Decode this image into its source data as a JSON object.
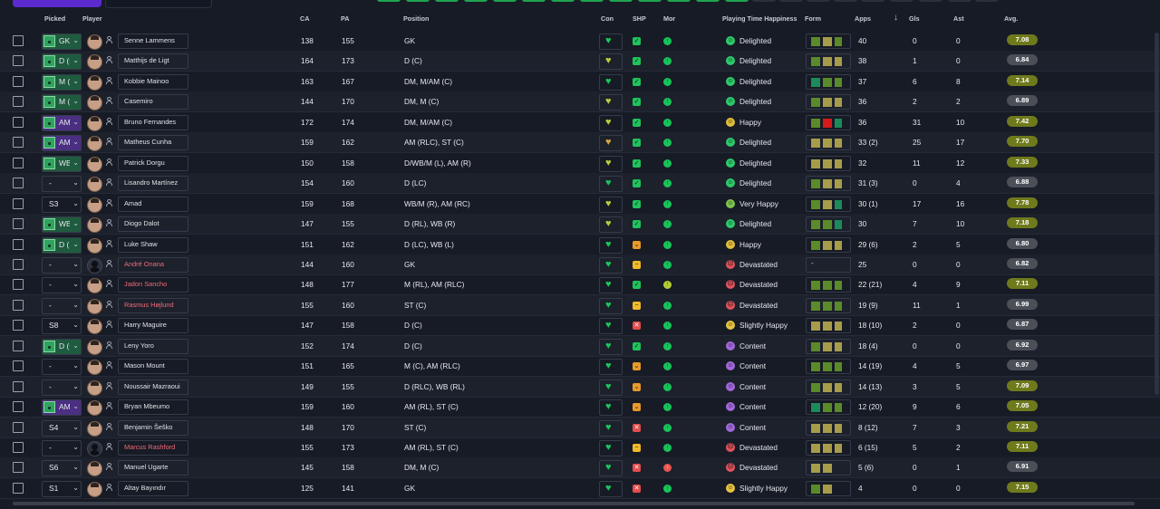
{
  "columns": {
    "picked": "Picked",
    "player": "Player",
    "ca": "CA",
    "pa": "PA",
    "position": "Position",
    "con": "Con",
    "shp": "SHP",
    "mor": "Mor",
    "happiness": "Playing Time Happiness",
    "form": "Form",
    "apps": "Apps",
    "sort_indicator": "↓",
    "gls": "Gls",
    "ast": "Ast",
    "avg": "Avg."
  },
  "colors": {
    "accent": "#5b2bd0",
    "toolbar_green": "#1ea34f",
    "form_green": "#5b8a2a",
    "form_olive": "#a79c4a",
    "form_teal": "#1c8a5b",
    "form_red": "#d41a1a"
  },
  "players": [
    {
      "picked": "GK",
      "pick_style": "g",
      "name": "Senne Lammens",
      "name_color": "white",
      "avatar": "photo",
      "ca": "138",
      "pa": "155",
      "position": "GK",
      "con": "g",
      "shp": "ok",
      "mor": "g",
      "happiness": "Delighted",
      "hap_icon": "dl",
      "form": [
        "#5b8a2a",
        "#a79c4a",
        "#5b8a2a"
      ],
      "apps": "40",
      "gls": "0",
      "ast": "0",
      "avg": "7.08",
      "avg_style": "ol"
    },
    {
      "picked": "D (C)",
      "pick_style": "g",
      "name": "Matthijs de Ligt",
      "name_color": "white",
      "avatar": "photo",
      "ca": "164",
      "pa": "173",
      "position": "D (C)",
      "con": "y",
      "shp": "ok",
      "mor": "g",
      "happiness": "Delighted",
      "hap_icon": "dl",
      "form": [
        "#5b8a2a",
        "#a79c4a",
        "#a79c4a"
      ],
      "apps": "38",
      "gls": "1",
      "ast": "0",
      "avg": "6.84",
      "avg_style": "gr"
    },
    {
      "picked": "M (C)",
      "pick_style": "g",
      "name": "Kobbie Mainoo",
      "name_color": "white",
      "avatar": "photo",
      "ca": "163",
      "pa": "167",
      "position": "DM, M/AM (C)",
      "con": "g",
      "shp": "ok",
      "mor": "g",
      "happiness": "Delighted",
      "hap_icon": "dl",
      "form": [
        "#1c8a5b",
        "#5b8a2a",
        "#5b8a2a"
      ],
      "apps": "37",
      "gls": "6",
      "ast": "8",
      "avg": "7.14",
      "avg_style": "ol"
    },
    {
      "picked": "M (C)",
      "pick_style": "g",
      "name": "Casemiro",
      "name_color": "white",
      "avatar": "photo",
      "ca": "144",
      "pa": "170",
      "position": "DM, M (C)",
      "con": "y",
      "shp": "ok",
      "mor": "g",
      "happiness": "Delighted",
      "hap_icon": "dl",
      "form": [
        "#5b8a2a",
        "#a79c4a",
        "#a79c4a"
      ],
      "apps": "36",
      "gls": "2",
      "ast": "2",
      "avg": "6.89",
      "avg_style": "gr"
    },
    {
      "picked": "AM (C)",
      "pick_style": "p",
      "name": "Bruno Fernandes",
      "name_color": "white",
      "avatar": "photo",
      "ca": "172",
      "pa": "174",
      "position": "DM, M/AM (C)",
      "con": "y",
      "shp": "ok",
      "mor": "g",
      "happiness": "Happy",
      "hap_icon": "hp",
      "form": [
        "#5b8a2a",
        "#d41a1a",
        "#1c8a5b"
      ],
      "apps": "36",
      "gls": "31",
      "ast": "10",
      "avg": "7.42",
      "avg_style": "ol"
    },
    {
      "picked": "AM (C)",
      "pick_style": "p",
      "name": "Matheus Cunha",
      "name_color": "white",
      "avatar": "photo",
      "ca": "159",
      "pa": "162",
      "position": "AM (RLC), ST (C)",
      "con": "o",
      "shp": "ok",
      "mor": "g",
      "happiness": "Delighted",
      "hap_icon": "dl",
      "form": [
        "#a79c4a",
        "#a79c4a",
        "#a79c4a"
      ],
      "apps": "33 (2)",
      "gls": "25",
      "ast": "17",
      "avg": "7.70",
      "avg_style": "ol"
    },
    {
      "picked": "WB (R)",
      "pick_style": "g",
      "name": "Patrick Dorgu",
      "name_color": "white",
      "avatar": "photo",
      "ca": "150",
      "pa": "158",
      "position": "D/WB/M (L), AM (R)",
      "con": "y",
      "shp": "ok",
      "mor": "g",
      "happiness": "Delighted",
      "hap_icon": "dl",
      "form": [
        "#a79c4a",
        "#a79c4a",
        "#a79c4a"
      ],
      "apps": "32",
      "gls": "11",
      "ast": "12",
      "avg": "7.33",
      "avg_style": "ol"
    },
    {
      "picked": "-",
      "pick_style": "ng",
      "name": "Lisandro Martínez",
      "name_color": "white",
      "avatar": "photo",
      "ca": "154",
      "pa": "160",
      "position": "D (LC)",
      "con": "g",
      "shp": "ok",
      "mor": "g",
      "happiness": "Delighted",
      "hap_icon": "dl",
      "form": [
        "#5b8a2a",
        "#a79c4a",
        "#a79c4a"
      ],
      "apps": "31 (3)",
      "gls": "0",
      "ast": "4",
      "avg": "6.88",
      "avg_style": "gr"
    },
    {
      "picked": "S3",
      "pick_style": "ng",
      "name": "Amad",
      "name_color": "white",
      "avatar": "photo",
      "ca": "159",
      "pa": "168",
      "position": "WB/M (R), AM (RC)",
      "con": "y",
      "shp": "ok",
      "mor": "g",
      "happiness": "Very Happy",
      "hap_icon": "vh",
      "form": [
        "#5b8a2a",
        "#a79c4a",
        "#1c8a5b"
      ],
      "apps": "30 (1)",
      "gls": "17",
      "ast": "16",
      "avg": "7.78",
      "avg_style": "ol"
    },
    {
      "picked": "WB (R)",
      "pick_style": "g",
      "name": "Diogo Dalot",
      "name_color": "white",
      "avatar": "photo",
      "ca": "147",
      "pa": "155",
      "position": "D (RL), WB (R)",
      "con": "y",
      "shp": "ok",
      "mor": "g",
      "happiness": "Delighted",
      "hap_icon": "dl",
      "form": [
        "#5b8a2a",
        "#5b8a2a",
        "#1c8a5b"
      ],
      "apps": "30",
      "gls": "7",
      "ast": "10",
      "avg": "7.18",
      "avg_style": "ol"
    },
    {
      "picked": "D (L)",
      "pick_style": "g",
      "name": "Luke Shaw",
      "name_color": "white",
      "avatar": "photo",
      "ca": "151",
      "pa": "162",
      "position": "D (LC), WB (L)",
      "con": "g",
      "shp": "warn",
      "mor": "g",
      "happiness": "Happy",
      "hap_icon": "hp",
      "form": [
        "#5b8a2a",
        "#a79c4a",
        "#a79c4a"
      ],
      "apps": "29 (6)",
      "gls": "2",
      "ast": "5",
      "avg": "6.80",
      "avg_style": "gr"
    },
    {
      "picked": "-",
      "pick_style": "ng",
      "name": "André Onana",
      "name_color": "red",
      "avatar": "sil",
      "ca": "144",
      "pa": "160",
      "position": "GK",
      "con": "g",
      "shp": "dash",
      "mor": "g",
      "happiness": "Devastated",
      "hap_icon": "dv",
      "form": [],
      "apps": "25",
      "gls": "0",
      "ast": "0",
      "avg": "6.82",
      "avg_style": "gr"
    },
    {
      "picked": "-",
      "pick_style": "ng",
      "name": "Jadon Sancho",
      "name_color": "red",
      "avatar": "photo",
      "ca": "148",
      "pa": "177",
      "position": "M (RL), AM (RLC)",
      "con": "g",
      "shp": "ok",
      "mor": "y",
      "happiness": "Devastated",
      "hap_icon": "dv",
      "form": [
        "#5b8a2a",
        "#5b8a2a",
        "#5b8a2a"
      ],
      "apps": "22 (21)",
      "gls": "4",
      "ast": "9",
      "avg": "7.11",
      "avg_style": "ol"
    },
    {
      "picked": "-",
      "pick_style": "ng",
      "name": "Rasmus Højlund",
      "name_color": "red",
      "avatar": "photo",
      "ca": "155",
      "pa": "160",
      "position": "ST (C)",
      "con": "g",
      "shp": "dash",
      "mor": "g",
      "happiness": "Devastated",
      "hap_icon": "dv",
      "form": [
        "#5b8a2a",
        "#5b8a2a",
        "#5b8a2a"
      ],
      "apps": "19 (9)",
      "gls": "11",
      "ast": "1",
      "avg": "6.99",
      "avg_style": "gr"
    },
    {
      "picked": "S8",
      "pick_style": "ng",
      "name": "Harry Maguire",
      "name_color": "white",
      "avatar": "photo",
      "ca": "147",
      "pa": "158",
      "position": "D (C)",
      "con": "g",
      "shp": "bad",
      "mor": "g",
      "happiness": "Slightly Happy",
      "hap_icon": "sh",
      "form": [
        "#a79c4a",
        "#a79c4a",
        "#a79c4a"
      ],
      "apps": "18 (10)",
      "gls": "2",
      "ast": "0",
      "avg": "6.87",
      "avg_style": "gr"
    },
    {
      "picked": "D (C)",
      "pick_style": "g",
      "name": "Leny Yoro",
      "name_color": "white",
      "avatar": "photo",
      "ca": "152",
      "pa": "174",
      "position": "D (C)",
      "con": "g",
      "shp": "ok",
      "mor": "g",
      "happiness": "Content",
      "hap_icon": "ct",
      "form": [
        "#5b8a2a",
        "#a79c4a",
        "#a79c4a"
      ],
      "apps": "18 (4)",
      "gls": "0",
      "ast": "0",
      "avg": "6.92",
      "avg_style": "gr"
    },
    {
      "picked": "-",
      "pick_style": "ng",
      "name": "Mason Mount",
      "name_color": "white",
      "avatar": "photo",
      "ca": "151",
      "pa": "165",
      "position": "M (C), AM (RLC)",
      "con": "g",
      "shp": "warn",
      "mor": "g",
      "happiness": "Content",
      "hap_icon": "ct",
      "form": [
        "#5b8a2a",
        "#5b8a2a",
        "#5b8a2a"
      ],
      "apps": "14 (19)",
      "gls": "4",
      "ast": "5",
      "avg": "6.97",
      "avg_style": "gr"
    },
    {
      "picked": "-",
      "pick_style": "ng",
      "name": "Noussair Mazraoui",
      "name_color": "white",
      "avatar": "photo",
      "ca": "149",
      "pa": "155",
      "position": "D (RLC), WB (RL)",
      "con": "g",
      "shp": "warn",
      "mor": "g",
      "happiness": "Content",
      "hap_icon": "ct",
      "form": [
        "#5b8a2a",
        "#a79c4a",
        "#a79c4a"
      ],
      "apps": "14 (13)",
      "gls": "3",
      "ast": "5",
      "avg": "7.09",
      "avg_style": "ol"
    },
    {
      "picked": "AM (C)",
      "pick_style": "p",
      "name": "Bryan Mbeumo",
      "name_color": "white",
      "avatar": "photo",
      "ca": "159",
      "pa": "160",
      "position": "AM (RL), ST (C)",
      "con": "g",
      "shp": "warn",
      "mor": "g",
      "happiness": "Content",
      "hap_icon": "ct",
      "form": [
        "#1c8a5b",
        "#5b8a2a",
        "#5b8a2a"
      ],
      "apps": "12 (20)",
      "gls": "9",
      "ast": "6",
      "avg": "7.05",
      "avg_style": "ol"
    },
    {
      "picked": "S4",
      "pick_style": "ng",
      "name": "Benjamin Šeško",
      "name_color": "white",
      "avatar": "photo",
      "ca": "148",
      "pa": "170",
      "position": "ST (C)",
      "con": "g",
      "shp": "bad",
      "mor": "g",
      "happiness": "Content",
      "hap_icon": "ct",
      "form": [
        "#a79c4a",
        "#a79c4a",
        "#a79c4a"
      ],
      "apps": "8 (12)",
      "gls": "7",
      "ast": "3",
      "avg": "7.21",
      "avg_style": "ol"
    },
    {
      "picked": "-",
      "pick_style": "ng",
      "name": "Marcus Rashford",
      "name_color": "red",
      "avatar": "sil",
      "ca": "155",
      "pa": "173",
      "position": "AM (RL), ST (C)",
      "con": "g",
      "shp": "dash",
      "mor": "g",
      "happiness": "Devastated",
      "hap_icon": "dv",
      "form": [
        "#a79c4a",
        "#a79c4a",
        "#a79c4a"
      ],
      "apps": "6 (15)",
      "gls": "5",
      "ast": "2",
      "avg": "7.11",
      "avg_style": "ol"
    },
    {
      "picked": "S6",
      "pick_style": "ng",
      "name": "Manuel Ugarte",
      "name_color": "white",
      "avatar": "photo",
      "ca": "145",
      "pa": "158",
      "position": "DM, M (C)",
      "con": "g",
      "shp": "bad",
      "mor": "r",
      "happiness": "Devastated",
      "hap_icon": "dv",
      "form": [
        "#a79c4a",
        "#a79c4a"
      ],
      "apps": "5 (6)",
      "gls": "0",
      "ast": "1",
      "avg": "6.91",
      "avg_style": "gr"
    },
    {
      "picked": "S1",
      "pick_style": "ng",
      "name": "Altay Bayındır",
      "name_color": "white",
      "avatar": "photo",
      "ca": "125",
      "pa": "141",
      "position": "GK",
      "con": "g",
      "shp": "bad",
      "mor": "g",
      "happiness": "Slightly Happy",
      "hap_icon": "sh",
      "form": [
        "#5b8a2a",
        "#a79c4a"
      ],
      "apps": "4",
      "gls": "0",
      "ast": "0",
      "avg": "7.15",
      "avg_style": "ol"
    }
  ]
}
